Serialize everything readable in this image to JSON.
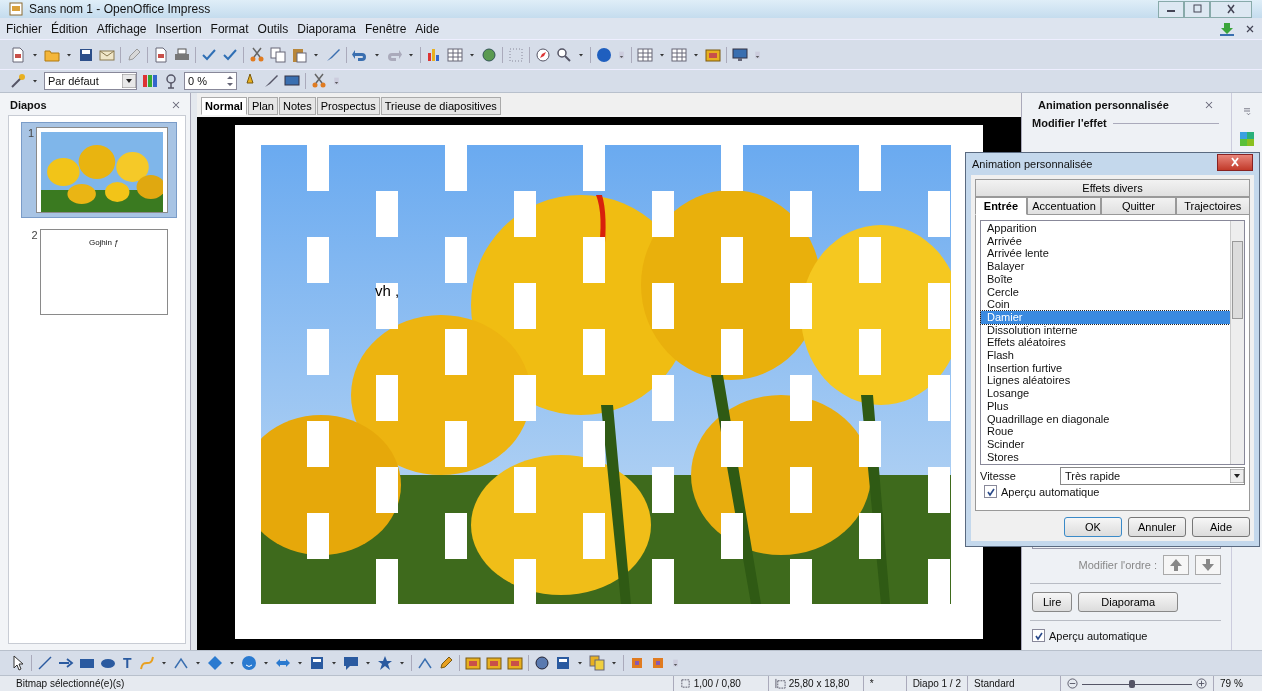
{
  "window": {
    "title": "Sans nom 1 - OpenOffice Impress"
  },
  "menu": [
    "Fichier",
    "Édition",
    "Affichage",
    "Insertion",
    "Format",
    "Outils",
    "Diaporama",
    "Fenêtre",
    "Aide"
  ],
  "format_bar": {
    "style_box": {
      "value": "Par défaut"
    },
    "transparency": {
      "value": "0 %"
    }
  },
  "slides_panel": {
    "title": "Diapos",
    "slides": [
      {
        "number": "1",
        "selected": true,
        "kind": "picture"
      },
      {
        "number": "2",
        "selected": false,
        "kind": "text",
        "text": "Gojhin ƒ"
      }
    ]
  },
  "view_tabs": [
    {
      "label": "Normal",
      "selected": true
    },
    {
      "label": "Plan",
      "selected": false
    },
    {
      "label": "Notes",
      "selected": false
    },
    {
      "label": "Prospectus",
      "selected": false
    },
    {
      "label": "Trieuse de diapositives",
      "selected": false
    }
  ],
  "slide": {
    "text": "vh ,"
  },
  "task_panel": {
    "title": "Animation personnalisée",
    "section": "Modifier l'effet",
    "order_label": "Modifier l'ordre :",
    "buttons": [
      "Lire",
      "Diaporama"
    ],
    "autopreview": {
      "label": "Aperçu automatique",
      "checked": true
    }
  },
  "dialog": {
    "title": "Animation personnalisée",
    "top_tabs": [
      {
        "label": "Effets divers",
        "selected": false
      }
    ],
    "tabs": [
      {
        "label": "Entrée",
        "selected": true
      },
      {
        "label": "Accentuation",
        "selected": false
      },
      {
        "label": "Quitter",
        "selected": false
      },
      {
        "label": "Trajectoires",
        "selected": false
      }
    ],
    "effects": [
      {
        "label": "Apparition",
        "selected": false
      },
      {
        "label": "Arrivée",
        "selected": false
      },
      {
        "label": "Arrivée lente",
        "selected": false
      },
      {
        "label": "Balayer",
        "selected": false
      },
      {
        "label": "Boîte",
        "selected": false
      },
      {
        "label": "Cercle",
        "selected": false
      },
      {
        "label": "Coin",
        "selected": false
      },
      {
        "label": "Damier",
        "selected": true
      },
      {
        "label": "Dissolution interne",
        "selected": false
      },
      {
        "label": "Effets aléatoires",
        "selected": false
      },
      {
        "label": "Flash",
        "selected": false
      },
      {
        "label": "Insertion furtive",
        "selected": false
      },
      {
        "label": "Lignes aléatoires",
        "selected": false
      },
      {
        "label": "Losange",
        "selected": false
      },
      {
        "label": "Plus",
        "selected": false
      },
      {
        "label": "Quadrillage en diagonale",
        "selected": false
      },
      {
        "label": "Roue",
        "selected": false
      },
      {
        "label": "Scinder",
        "selected": false
      },
      {
        "label": "Stores",
        "selected": false
      }
    ],
    "speed_label": "Vitesse",
    "speed": "Très rapide",
    "autopreview": {
      "label": "Aperçu automatique",
      "checked": true
    },
    "buttons": [
      "OK",
      "Annuler",
      "Aide"
    ]
  },
  "drawing_toolbar": {
    "text_tool": "T"
  },
  "status_bar": {
    "message": "Bitmap sélectionné(e)(s)",
    "position": "1,00 / 0,80",
    "size": "25,80 x 18,80",
    "modified": "*",
    "slide": "Diapo 1 / 2",
    "layout": "Standard",
    "zoom": {
      "level": 0.45,
      "reading": "79 %"
    }
  }
}
